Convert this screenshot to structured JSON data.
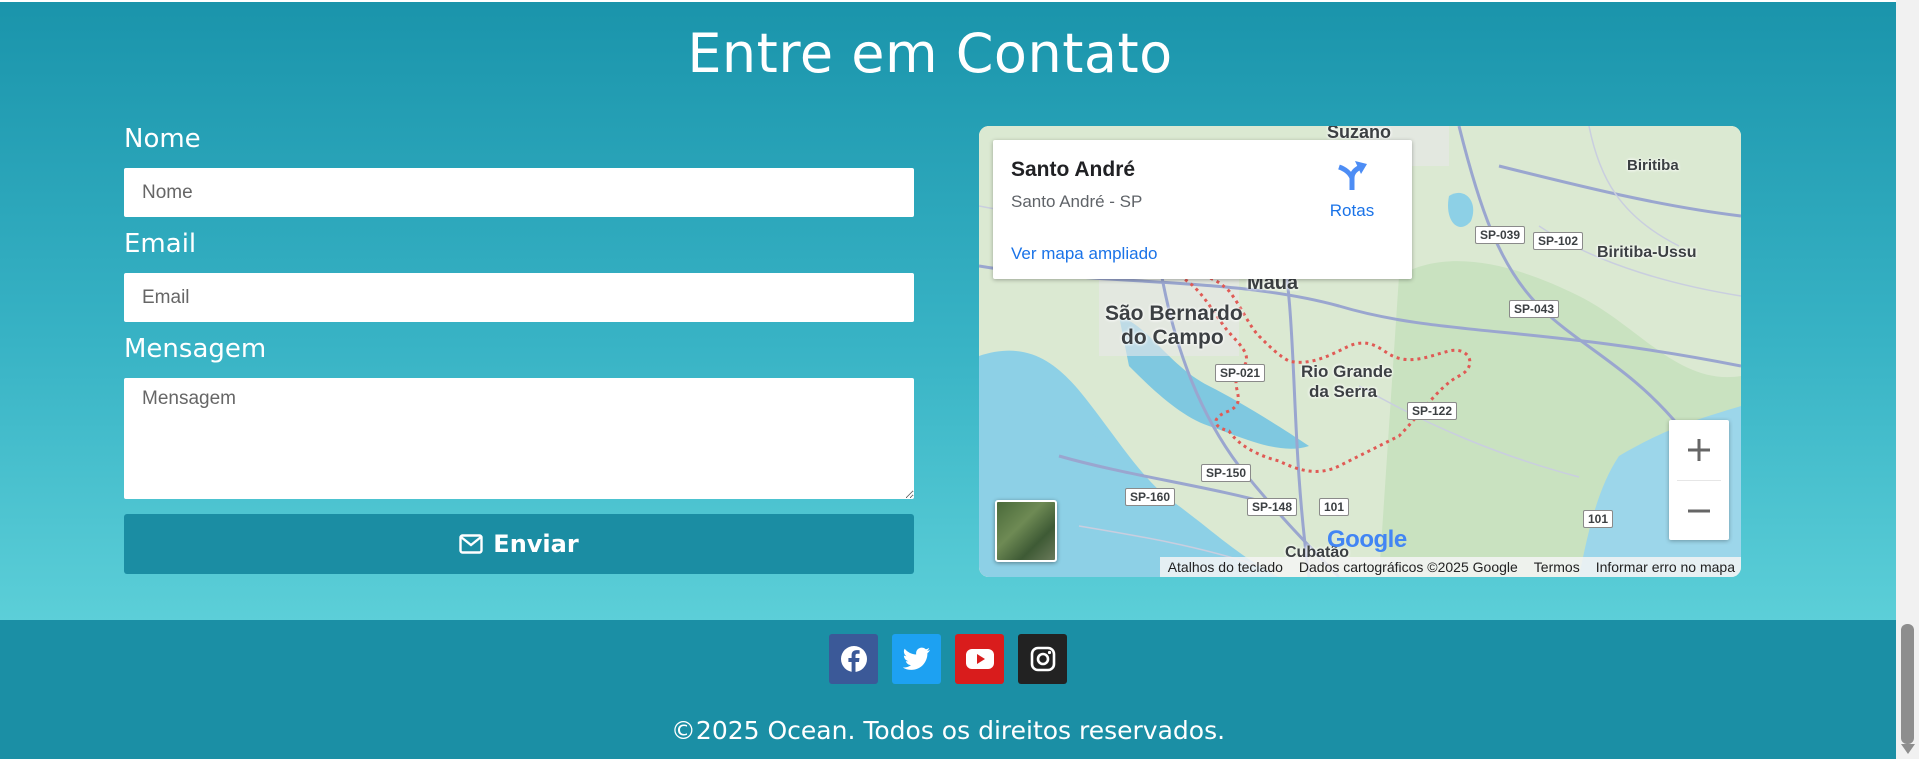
{
  "contact": {
    "title": "Entre em Contato",
    "name_label": "Nome",
    "name_placeholder": "Nome",
    "email_label": "Email",
    "email_placeholder": "Email",
    "message_label": "Mensagem",
    "message_placeholder": "Mensagem",
    "send_label": "Enviar",
    "send_icon": "envelope-icon"
  },
  "map": {
    "place_name": "Santo André",
    "place_address": "Santo André - SP",
    "directions_label": "Rotas",
    "larger_map_link": "Ver mapa ampliado",
    "labels": {
      "suzano": "Suzano",
      "maua": "Mauá",
      "sao_bernardo_1": "São Bernardo",
      "sao_bernardo_2": "do Campo",
      "rio_grande_1": "Rio Grande",
      "rio_grande_2": "da Serra",
      "biritiba": "Biritiba-Ussu",
      "biritiba_top": "Biritiba",
      "cubatao": "Cubatão"
    },
    "shields": {
      "sp039": "SP-039",
      "sp102": "SP-102",
      "sp043": "SP-043",
      "sp021": "SP-021",
      "sp122": "SP-122",
      "sp150": "SP-150",
      "sp160": "SP-160",
      "sp148": "SP-148",
      "r101a": "101",
      "r101b": "101"
    },
    "google_logo": "Google",
    "attribution": {
      "shortcuts": "Atalhos do teclado",
      "data": "Dados cartográficos ©2025 Google",
      "terms": "Termos",
      "report": "Informar erro no mapa"
    }
  },
  "footer": {
    "social": [
      "facebook-icon",
      "twitter-icon",
      "youtube-icon",
      "instagram-icon"
    ],
    "social_colors": [
      "#3b5998",
      "#1da1f2",
      "#d91c1c",
      "#222222"
    ],
    "copyright": "©2025 Ocean. Todos os direitos reservados."
  }
}
